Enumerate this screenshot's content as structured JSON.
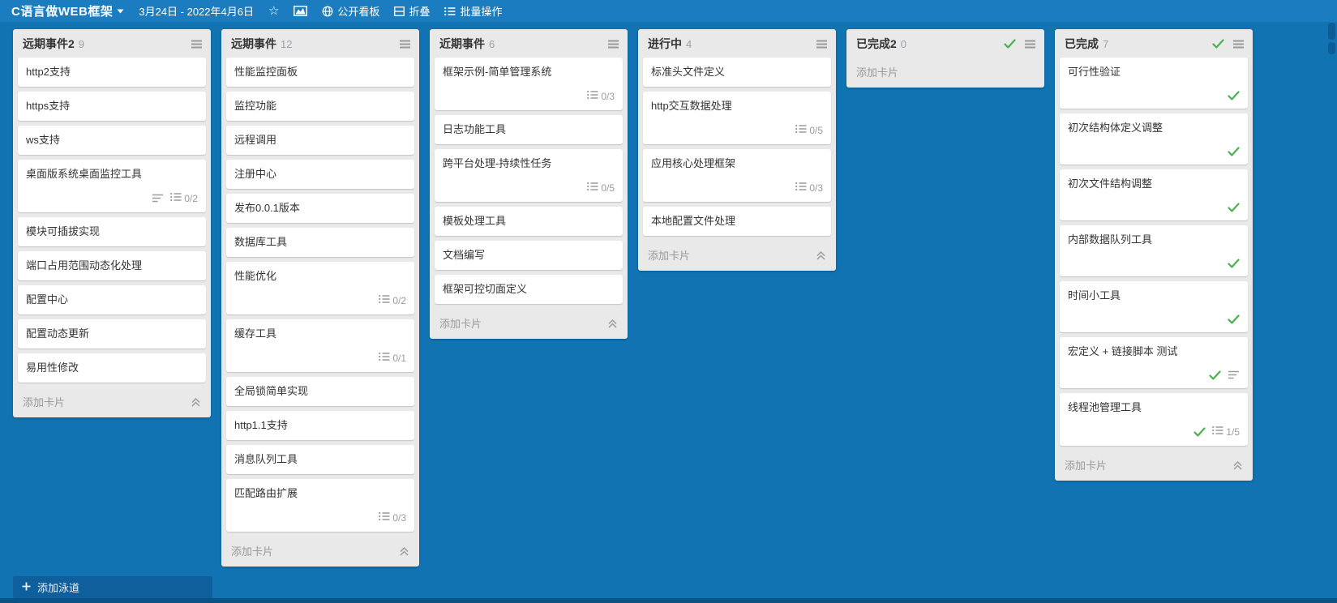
{
  "topbar": {
    "board_title": "C语言做WEB框架",
    "date_range": "3月24日 - 2022年4月6日",
    "actions": {
      "public_board": "公开看板",
      "fold": "折叠",
      "batch_ops": "批量操作"
    }
  },
  "board": {
    "add_card_label": "添加卡片",
    "add_lane_label": "添加泳道",
    "columns": [
      {
        "title": "远期事件2",
        "count": "9",
        "header_check": false,
        "collapse_toggle": true,
        "cards": [
          {
            "title": "http2支持"
          },
          {
            "title": "https支持"
          },
          {
            "title": "ws支持"
          },
          {
            "title": "桌面版系统桌面监控工具",
            "description": true,
            "checklist": "0/2"
          },
          {
            "title": "模块可插拔实现"
          },
          {
            "title": "端口占用范围动态化处理"
          },
          {
            "title": "配置中心"
          },
          {
            "title": "配置动态更新"
          },
          {
            "title": "易用性修改"
          }
        ]
      },
      {
        "title": "远期事件",
        "count": "12",
        "header_check": false,
        "collapse_toggle": true,
        "cards": [
          {
            "title": "性能监控面板"
          },
          {
            "title": "监控功能"
          },
          {
            "title": "远程调用"
          },
          {
            "title": "注册中心"
          },
          {
            "title": "发布0.0.1版本"
          },
          {
            "title": "数据库工具"
          },
          {
            "title": "性能优化",
            "checklist": "0/2"
          },
          {
            "title": "缓存工具",
            "checklist": "0/1"
          },
          {
            "title": "全局锁简单实现"
          },
          {
            "title": "http1.1支持"
          },
          {
            "title": "消息队列工具"
          },
          {
            "title": "匹配路由扩展",
            "checklist": "0/3"
          }
        ]
      },
      {
        "title": "近期事件",
        "count": "6",
        "header_check": false,
        "collapse_toggle": true,
        "cards": [
          {
            "title": "框架示例-简单管理系统",
            "checklist": "0/3"
          },
          {
            "title": "日志功能工具"
          },
          {
            "title": "跨平台处理-持续性任务",
            "checklist": "0/5"
          },
          {
            "title": "模板处理工具"
          },
          {
            "title": "文档编写"
          },
          {
            "title": "框架可控切面定义"
          }
        ]
      },
      {
        "title": "进行中",
        "count": "4",
        "header_check": false,
        "collapse_toggle": true,
        "cards": [
          {
            "title": "标准头文件定义"
          },
          {
            "title": "http交互数据处理",
            "checklist": "0/5"
          },
          {
            "title": "应用核心处理框架",
            "checklist": "0/3"
          },
          {
            "title": "本地配置文件处理"
          }
        ]
      },
      {
        "title": "已完成2",
        "count": "0",
        "header_check": true,
        "collapse_toggle": false,
        "cards": []
      },
      {
        "title": "已完成",
        "count": "7",
        "header_check": true,
        "collapse_toggle": true,
        "cards": [
          {
            "title": "可行性验证",
            "done": true
          },
          {
            "title": "初次结构体定义调整",
            "done": true
          },
          {
            "title": "初次文件结构调整",
            "done": true
          },
          {
            "title": "内部数据队列工具",
            "done": true
          },
          {
            "title": "时间小工具",
            "done": true
          },
          {
            "title": "宏定义 + 链接脚本 测试",
            "done": true,
            "description": true
          },
          {
            "title": "线程池管理工具",
            "done": true,
            "checklist": "1/5"
          }
        ]
      }
    ]
  },
  "colors": {
    "topbar_bg": "#1b7dbf",
    "board_bg": "#1173b2",
    "column_bg": "#e9e9e9",
    "card_bg": "#ffffff",
    "done_green": "#4caf50",
    "muted_text": "#999999",
    "card_text": "#333333",
    "add_lane_bg": "#0e5f9c"
  },
  "icons": {
    "dropdown-caret": "▾",
    "star": "☆",
    "chart": "🗠",
    "globe": "🌐",
    "fold": "⊟",
    "batch-list": "≔",
    "column-menu": "≡",
    "done-check": "✓",
    "description": "☰",
    "checklist": "≣",
    "collapse": "⌃⌃",
    "plus": "＋"
  }
}
